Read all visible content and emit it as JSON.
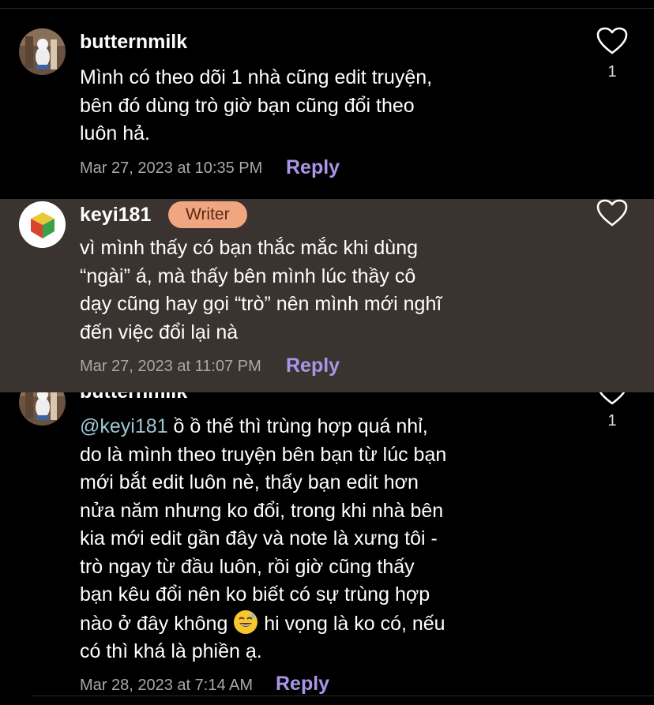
{
  "comments": [
    {
      "username": "butternmilk",
      "lines": [
        "Mình có theo dõi 1 nhà cũng edit truyện,",
        "bên đó dùng trò giờ bạn cũng đổi theo",
        "luôn hả."
      ],
      "timestamp": "Mar 27, 2023 at 10:35 PM",
      "reply_label": "Reply",
      "likes": "1"
    },
    {
      "username": "keyi181",
      "badge": "Writer",
      "lines": [
        "vì mình thấy có bạn thắc mắc khi dùng",
        "“ngài” á, mà thấy bên mình lúc thầy cô",
        "dạy cũng hay gọi “trò” nên mình mới nghĩ",
        "đến việc đổi lại nà"
      ],
      "timestamp": "Mar 27, 2023 at 11:07 PM",
      "reply_label": "Reply"
    },
    {
      "username": "butternmilk",
      "mention": "@keyi181",
      "lines": [
        " ồ ồ thế thì trùng hợp quá nhỉ,",
        "do là mình theo truyện bên bạn từ lúc bạn",
        "mới bắt edit luôn nè, thấy bạn edit hơn",
        "nửa năm nhưng ko đổi, trong khi nhà bên",
        "kia mới edit gần đây và note là xưng tôi -",
        "trò ngay từ đầu luôn, rồi giờ cũng thấy",
        "bạn kêu đổi nên ko biết có sự trùng hợp",
        "nào ở đây không ",
        " hi vọng là ko có, nếu",
        "có thì khá là phiền ạ."
      ],
      "timestamp": "Mar 28, 2023 at 7:14 AM",
      "reply_label": "Reply",
      "likes": "1"
    }
  ],
  "colors": {
    "background": "#000000",
    "highlight_background": "#3a3330",
    "reply": "#a996e8",
    "writer_badge": "#f0a681",
    "mention": "#9ec7d6"
  }
}
